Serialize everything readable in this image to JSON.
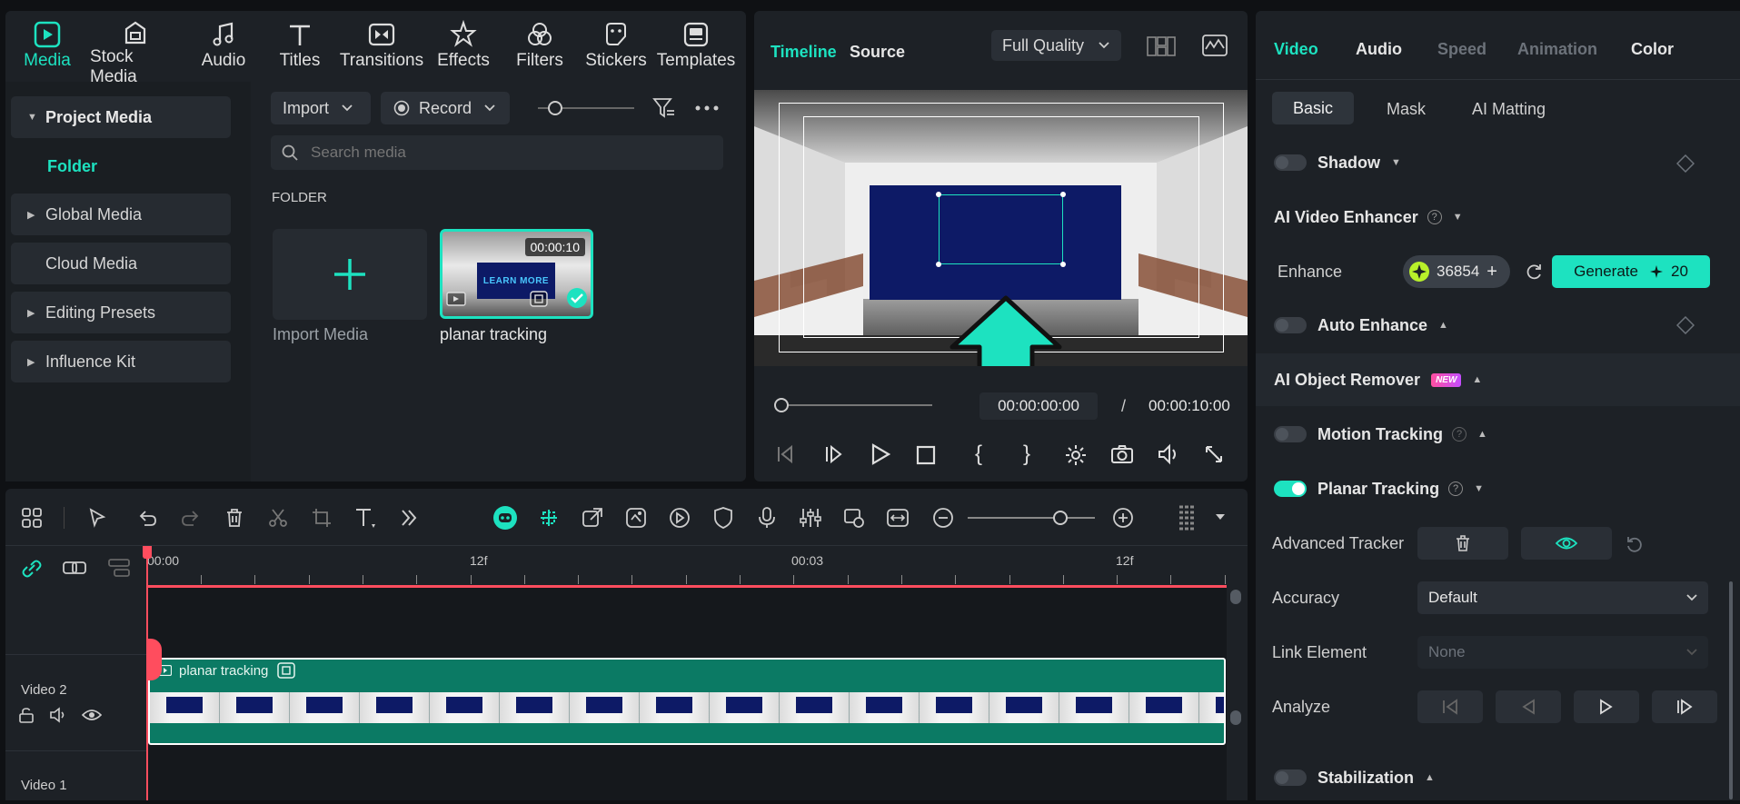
{
  "top_tabs": [
    {
      "label": "Media",
      "icon": "media-icon",
      "active": true
    },
    {
      "label": "Stock Media",
      "icon": "stock-media-icon"
    },
    {
      "label": "Audio",
      "icon": "audio-note-icon"
    },
    {
      "label": "Titles",
      "icon": "titles-t-icon"
    },
    {
      "label": "Transitions",
      "icon": "transitions-icon"
    },
    {
      "label": "Effects",
      "icon": "effects-icon"
    },
    {
      "label": "Filters",
      "icon": "filters-icon"
    },
    {
      "label": "Stickers",
      "icon": "stickers-icon"
    },
    {
      "label": "Templates",
      "icon": "templates-icon"
    }
  ],
  "sidebar": {
    "project_media": "Project Media",
    "folder": "Folder",
    "global_media": "Global Media",
    "cloud_media": "Cloud Media",
    "editing_presets": "Editing Presets",
    "influence_kit": "Influence Kit"
  },
  "media": {
    "import_label": "Import",
    "record_label": "Record",
    "search_placeholder": "Search media",
    "folder_heading": "FOLDER",
    "import_media_label": "Import Media",
    "clip_name": "planar tracking",
    "clip_duration": "00:00:10",
    "thumb_text": "LEARN MORE"
  },
  "player": {
    "tab_timeline": "Timeline",
    "tab_source": "Source",
    "quality": "Full Quality",
    "current_time": "00:00:00:00",
    "separator": "/",
    "total_time": "00:00:10:00"
  },
  "timeline": {
    "ruler": [
      "00:00",
      "12f",
      "00:03",
      "12f"
    ],
    "track2_label": "Video 2",
    "track1_label": "Video 1",
    "clip_label": "planar tracking"
  },
  "props": {
    "tabs": [
      "Video",
      "Audio",
      "Speed",
      "Animation",
      "Color"
    ],
    "subtabs": [
      "Basic",
      "Mask",
      "AI Matting"
    ],
    "shadow": "Shadow",
    "ai_video_enhancer": "AI Video Enhancer",
    "enhance": "Enhance",
    "credits": "36854",
    "generate": "Generate",
    "generate_cost": "20",
    "auto_enhance": "Auto Enhance",
    "ai_object_remover": "AI Object Remover",
    "new_badge": "NEW",
    "motion_tracking": "Motion Tracking",
    "planar_tracking": "Planar Tracking",
    "advanced_tracker": "Advanced Tracker",
    "accuracy": "Accuracy",
    "accuracy_value": "Default",
    "link_element": "Link Element",
    "link_value": "None",
    "analyze": "Analyze",
    "stabilization": "Stabilization"
  },
  "colors": {
    "accent": "#1de2c0",
    "playhead": "#ff4d5e",
    "clip_green": "#0b7a64"
  }
}
